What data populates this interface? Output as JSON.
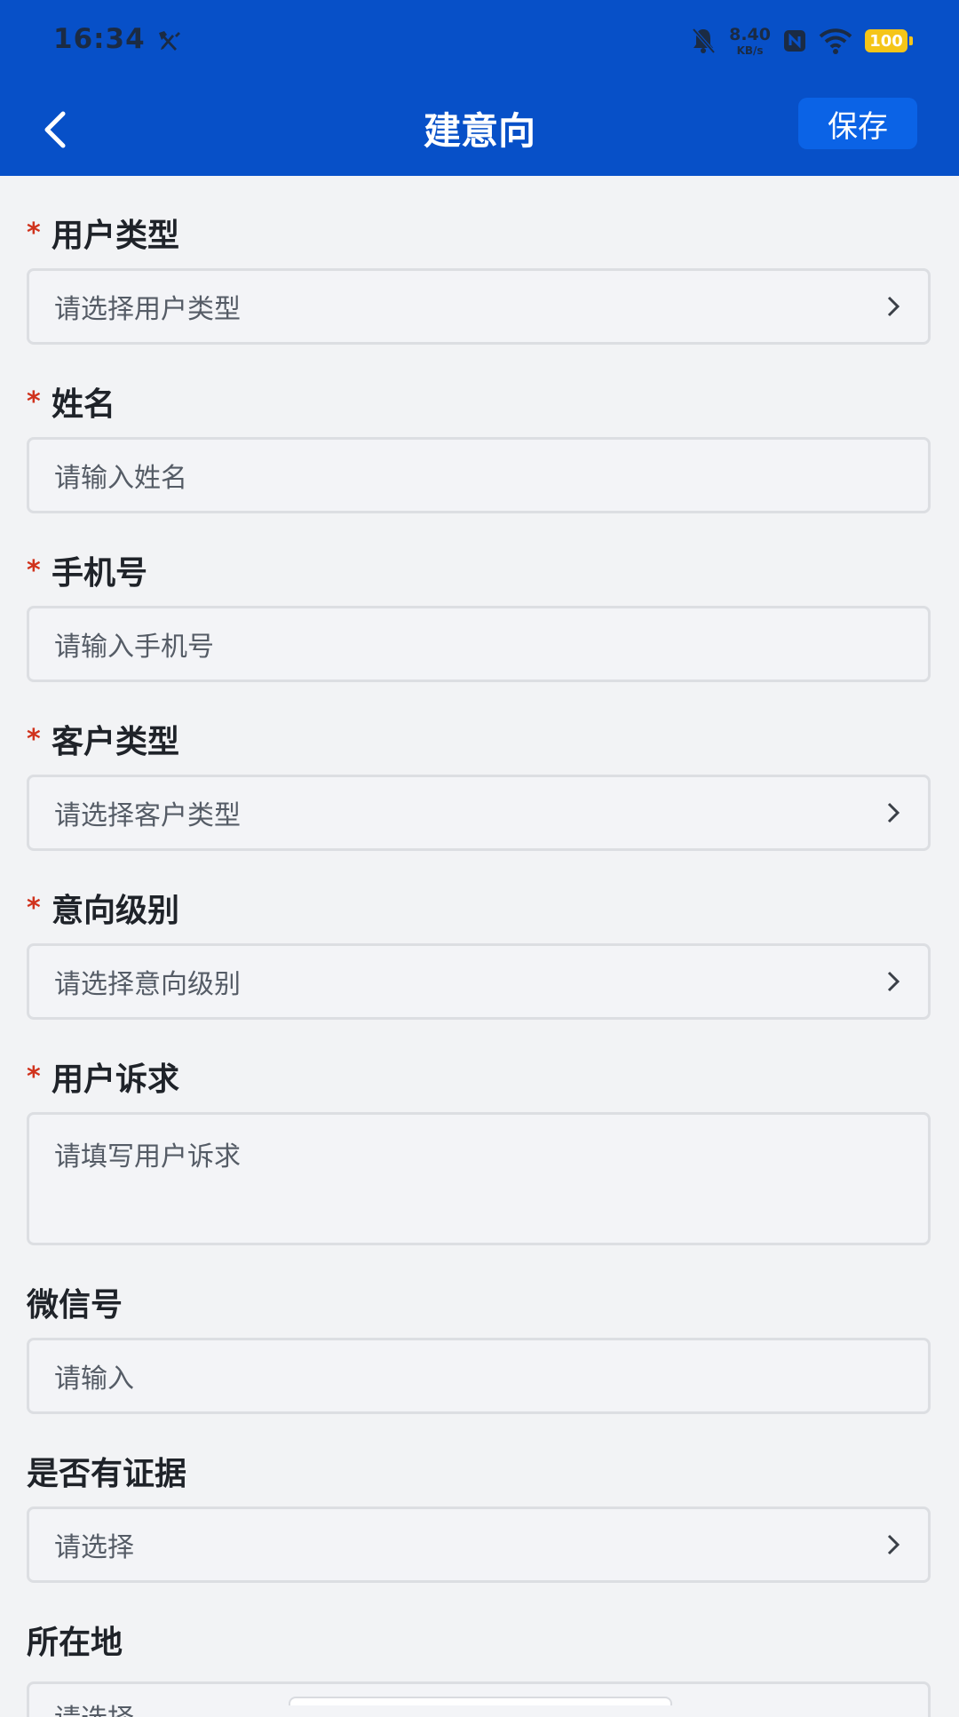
{
  "status_bar": {
    "time": "16:34",
    "network_speed": "8.40",
    "network_unit": "KB/s",
    "battery": "100",
    "tool_icon": "hammer-wrench-icon",
    "bell_icon": "bell-muted-icon",
    "nfc_icon": "nfc-icon",
    "wifi_icon": "wifi-icon"
  },
  "nav": {
    "title": "建意向",
    "save_label": "保存",
    "back_icon": "back-arrow-icon",
    "bar_color": "#0750c8"
  },
  "fields": [
    {
      "label": "用户类型",
      "required": true,
      "placeholder": "请选择用户类型",
      "kind": "select"
    },
    {
      "label": "姓名",
      "required": true,
      "placeholder": "请输入姓名",
      "kind": "input"
    },
    {
      "label": "手机号",
      "required": true,
      "placeholder": "请输入手机号",
      "kind": "input"
    },
    {
      "label": "客户类型",
      "required": true,
      "placeholder": "请选择客户类型",
      "kind": "select"
    },
    {
      "label": "意向级别",
      "required": true,
      "placeholder": "请选择意向级别",
      "kind": "select"
    },
    {
      "label": "用户诉求",
      "required": true,
      "placeholder": "请填写用户诉求",
      "kind": "textarea"
    },
    {
      "label": "微信号",
      "required": false,
      "placeholder": "请输入",
      "kind": "input"
    },
    {
      "label": "是否有证据",
      "required": false,
      "placeholder": "请选择",
      "kind": "select"
    },
    {
      "label": "所在地",
      "required": false,
      "placeholder": "请选择",
      "kind": "select"
    }
  ],
  "required_mark": "*",
  "colors": {
    "required": "#d0321c",
    "save_button": "#0b63e6",
    "background": "#f2f3f5"
  }
}
